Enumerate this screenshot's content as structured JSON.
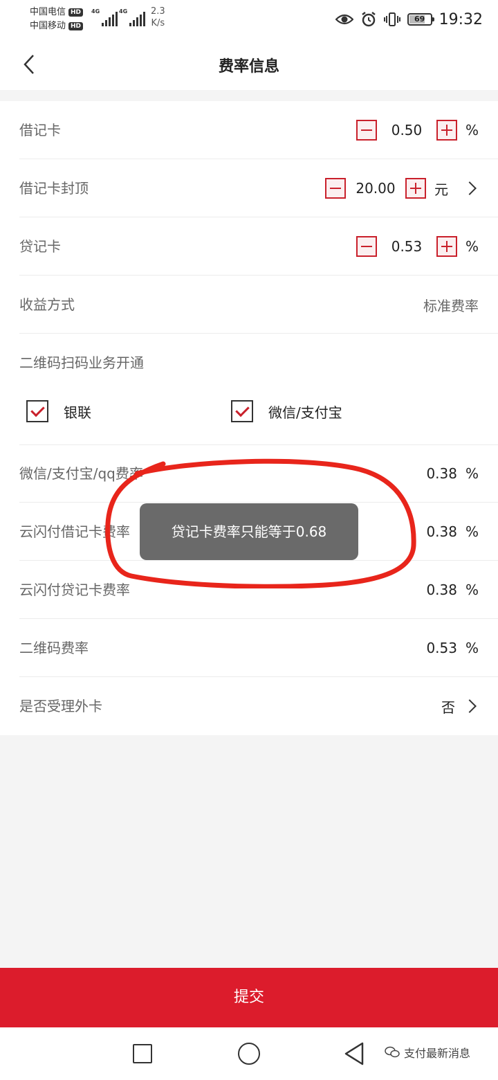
{
  "status_bar": {
    "carrier1": "中国电信",
    "carrier2": "中国移动",
    "hd_badge": "HD",
    "net_type": "4G",
    "net_speed_value": "2.3",
    "net_speed_unit": "K/s",
    "battery": "69",
    "time": "19:32",
    "icons": [
      "eye-icon",
      "alarm-icon",
      "vibrate-icon",
      "battery-icon"
    ]
  },
  "header": {
    "title": "费率信息",
    "back_icon": "chevron-left-icon"
  },
  "rates": {
    "debit": {
      "label": "借记卡",
      "value": "0.50",
      "unit": "%"
    },
    "debit_cap": {
      "label": "借记卡封顶",
      "value": "20.00",
      "unit": "元"
    },
    "credit": {
      "label": "贷记卡",
      "value": "0.53",
      "unit": "%"
    },
    "income_mode": {
      "label": "收益方式",
      "value": "标准费率"
    },
    "qr_business": {
      "label": "二维码扫码业务开通"
    },
    "checks": {
      "unionpay": {
        "label": "银联",
        "checked": true
      },
      "wechat_alipay": {
        "label": "微信/支付宝",
        "checked": true
      }
    },
    "wechat_rate": {
      "label": "微信/支付宝/qq费率",
      "value": "0.38",
      "unit": "%"
    },
    "cloud_debit": {
      "label": "云闪付借记卡费率",
      "value": "0.38",
      "unit": "%"
    },
    "cloud_credit": {
      "label": "云闪付贷记卡费率",
      "value": "0.38",
      "unit": "%"
    },
    "qr_rate": {
      "label": "二维码费率",
      "value": "0.53",
      "unit": "%"
    },
    "foreign_card": {
      "label": "是否受理外卡",
      "value": "否"
    }
  },
  "toast": {
    "message": "贷记卡费率只能等于0.68"
  },
  "submit": {
    "label": "提交"
  },
  "navbar": {
    "icons": [
      "square-icon",
      "circle-icon",
      "triangle-back-icon"
    ]
  },
  "watermark": {
    "text": "支付最新消息"
  },
  "colors": {
    "accent": "#dc1c2c",
    "toast_bg": "#6a6a6a",
    "annotation": "#e8251b"
  }
}
